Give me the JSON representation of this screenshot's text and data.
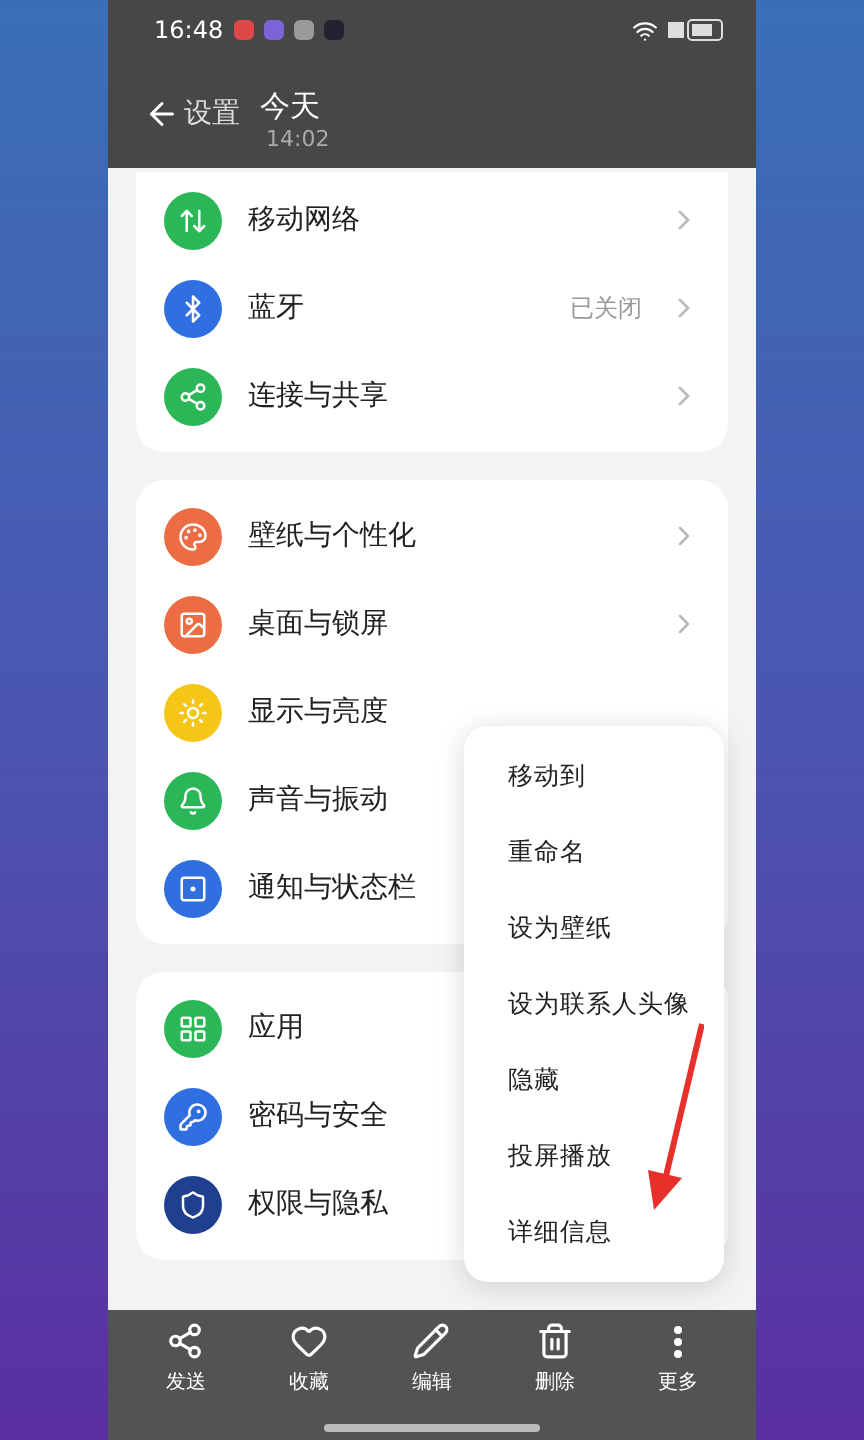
{
  "status_bar": {
    "time": "16:48"
  },
  "header": {
    "back_label": "设置",
    "title": "今天",
    "subtitle": "14:02"
  },
  "groups": [
    {
      "items": [
        {
          "label": "移动网络",
          "kind": "network",
          "color": "#2bb757",
          "chevron": true
        },
        {
          "label": "蓝牙",
          "kind": "bluetooth",
          "color": "#2f6fdf",
          "value": "已关闭",
          "chevron": true
        },
        {
          "label": "连接与共享",
          "kind": "share",
          "color": "#2bb757",
          "chevron": true
        }
      ]
    },
    {
      "items": [
        {
          "label": "壁纸与个性化",
          "kind": "palette",
          "color": "#ec6c44",
          "chevron": true
        },
        {
          "label": "桌面与锁屏",
          "kind": "image",
          "color": "#ec6c44",
          "chevron": true
        },
        {
          "label": "显示与亮度",
          "kind": "sun",
          "color": "#f5c518",
          "chevron": false
        },
        {
          "label": "声音与振动",
          "kind": "bell",
          "color": "#2bb757",
          "chevron": false
        },
        {
          "label": "通知与状态栏",
          "kind": "note",
          "color": "#2f6fdf",
          "chevron": false
        }
      ]
    },
    {
      "items": [
        {
          "label": "应用",
          "kind": "grid",
          "color": "#2bb757",
          "chevron": false
        },
        {
          "label": "密码与安全",
          "kind": "key",
          "color": "#2f6fdf",
          "chevron": false
        },
        {
          "label": "权限与隐私",
          "kind": "shield",
          "color": "#1f3f8f",
          "chevron": false
        }
      ]
    }
  ],
  "menu": [
    "移动到",
    "重命名",
    "设为壁纸",
    "设为联系人头像",
    "隐藏",
    "投屏播放",
    "详细信息"
  ],
  "toolbar": [
    {
      "label": "发送",
      "kind": "share"
    },
    {
      "label": "收藏",
      "kind": "heart"
    },
    {
      "label": "编辑",
      "kind": "pencil"
    },
    {
      "label": "删除",
      "kind": "trash"
    },
    {
      "label": "更多",
      "kind": "more"
    }
  ]
}
